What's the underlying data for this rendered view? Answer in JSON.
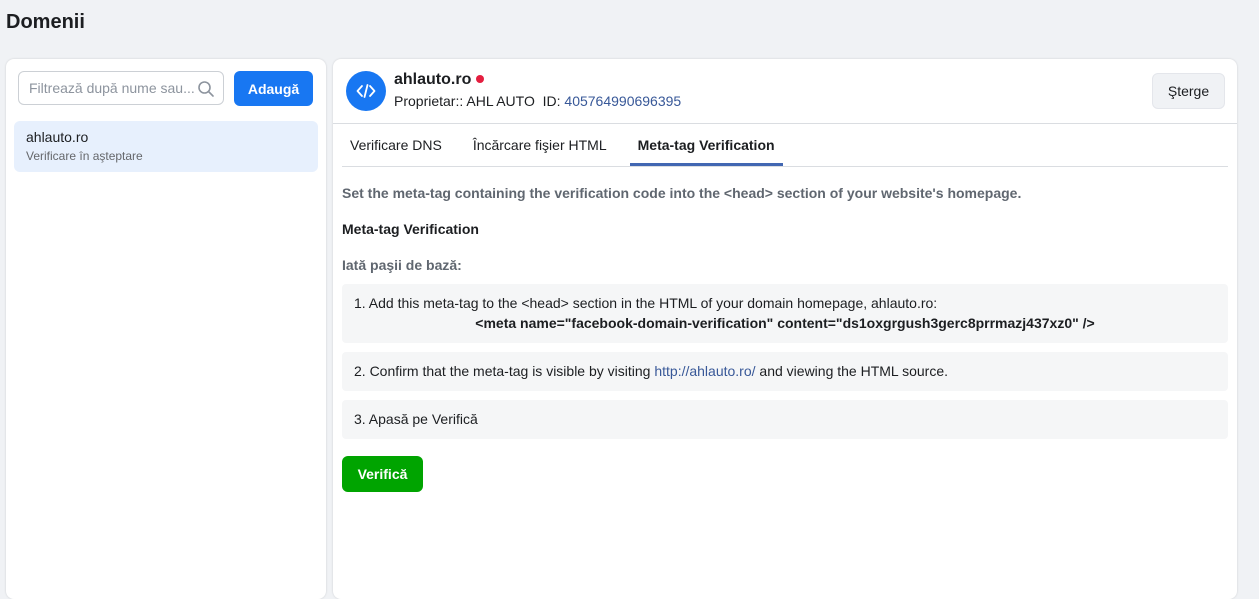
{
  "page": {
    "title": "Domenii"
  },
  "sidebar": {
    "search_placeholder": "Filtrează după nume sau...",
    "add_label": "Adaugă",
    "items": [
      {
        "name": "ahlauto.ro",
        "status": "Verificare în aşteptare"
      }
    ]
  },
  "detail": {
    "domain": "ahlauto.ro",
    "owner_label": "Proprietar::",
    "owner_name": "AHL AUTO",
    "id_label": "ID:",
    "id_value": "405764990696395",
    "delete_label": "Şterge",
    "tabs": [
      {
        "label": "Verificare DNS",
        "active": false
      },
      {
        "label": "Încărcare fişier HTML",
        "active": false
      },
      {
        "label": "Meta-tag Verification",
        "active": true
      }
    ],
    "intro": "Set the meta-tag containing the verification code into the <head> section of your website's homepage.",
    "section_title": "Meta-tag Verification",
    "steps_label": "Iată paşii de bază:",
    "step1_text": "1. Add this meta-tag to the <head> section in the HTML of your domain homepage, ahlauto.ro:",
    "step1_code": "<meta name=\"facebook-domain-verification\" content=\"ds1oxgrgush3gerc8prrmazj437xz0\" />",
    "step2_prefix": "2. Confirm that the meta-tag is visible by visiting ",
    "step2_link": "http://ahlauto.ro/",
    "step2_suffix": " and viewing the HTML source.",
    "step3_text": "3. Apasă pe Verifică",
    "verify_label": "Verifică"
  },
  "colors": {
    "primary": "#1877f2",
    "success": "#00a400",
    "status_dot": "#e41e3f",
    "link": "#385898",
    "selected_bg": "#e7f0fd"
  },
  "icons": {
    "search": "search-icon",
    "domain": "code-icon"
  }
}
